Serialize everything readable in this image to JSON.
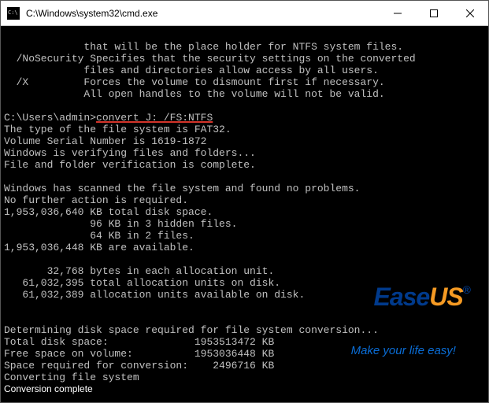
{
  "window": {
    "title": "C:\\Windows\\system32\\cmd.exe"
  },
  "help": {
    "line1": "             that will be the place holder for NTFS system files.",
    "line2": "  /NoSecurity Specifies that the security settings on the converted",
    "line3": "             files and directories allow access by all users.",
    "line4": "  /X         Forces the volume to dismount first if necessary.",
    "line5": "             All open handles to the volume will not be valid."
  },
  "prompt": {
    "path": "C:\\Users\\admin>",
    "command": "convert J: /FS:NTFS"
  },
  "out": {
    "l1": "The type of the file system is FAT32.",
    "l2": "Volume Serial Number is 1619-1872",
    "l3": "Windows is verifying files and folders...",
    "l4": "File and folder verification is complete.",
    "l5": "Windows has scanned the file system and found no problems.",
    "l6": "No further action is required.",
    "l7": "1,953,036,640 KB total disk space.",
    "l8": "              96 KB in 3 hidden files.",
    "l9": "              64 KB in 2 files.",
    "l10": "1,953,036,448 KB are available.",
    "l11": "       32,768 bytes in each allocation unit.",
    "l12": "   61,032,395 total allocation units on disk.",
    "l13": "   61,032,389 allocation units available on disk.",
    "l14": "Determining disk space required for file system conversion...",
    "l15": "Total disk space:              1953513472 KB",
    "l16": "Free space on volume:          1953036448 KB",
    "l17": "Space required for conversion:    2496716 KB",
    "l18": "Converting file system"
  },
  "status": "Conversion complete",
  "watermark": {
    "brand_left": "Ease",
    "brand_right": "US",
    "reg": "®",
    "tagline": "Make your life easy!"
  }
}
